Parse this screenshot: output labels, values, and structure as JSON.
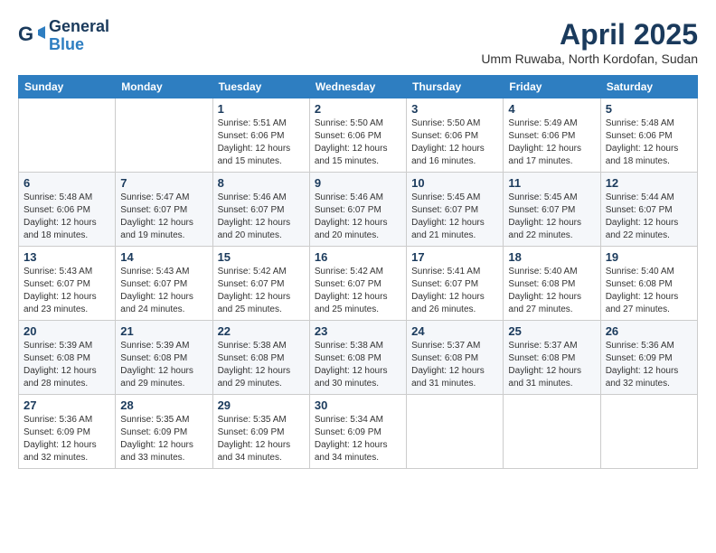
{
  "header": {
    "logo_line1": "General",
    "logo_line2": "Blue",
    "month_title": "April 2025",
    "location": "Umm Ruwaba, North Kordofan, Sudan"
  },
  "days_of_week": [
    "Sunday",
    "Monday",
    "Tuesday",
    "Wednesday",
    "Thursday",
    "Friday",
    "Saturday"
  ],
  "weeks": [
    [
      {
        "num": "",
        "info": ""
      },
      {
        "num": "",
        "info": ""
      },
      {
        "num": "1",
        "info": "Sunrise: 5:51 AM\nSunset: 6:06 PM\nDaylight: 12 hours and 15 minutes."
      },
      {
        "num": "2",
        "info": "Sunrise: 5:50 AM\nSunset: 6:06 PM\nDaylight: 12 hours and 15 minutes."
      },
      {
        "num": "3",
        "info": "Sunrise: 5:50 AM\nSunset: 6:06 PM\nDaylight: 12 hours and 16 minutes."
      },
      {
        "num": "4",
        "info": "Sunrise: 5:49 AM\nSunset: 6:06 PM\nDaylight: 12 hours and 17 minutes."
      },
      {
        "num": "5",
        "info": "Sunrise: 5:48 AM\nSunset: 6:06 PM\nDaylight: 12 hours and 18 minutes."
      }
    ],
    [
      {
        "num": "6",
        "info": "Sunrise: 5:48 AM\nSunset: 6:06 PM\nDaylight: 12 hours and 18 minutes."
      },
      {
        "num": "7",
        "info": "Sunrise: 5:47 AM\nSunset: 6:07 PM\nDaylight: 12 hours and 19 minutes."
      },
      {
        "num": "8",
        "info": "Sunrise: 5:46 AM\nSunset: 6:07 PM\nDaylight: 12 hours and 20 minutes."
      },
      {
        "num": "9",
        "info": "Sunrise: 5:46 AM\nSunset: 6:07 PM\nDaylight: 12 hours and 20 minutes."
      },
      {
        "num": "10",
        "info": "Sunrise: 5:45 AM\nSunset: 6:07 PM\nDaylight: 12 hours and 21 minutes."
      },
      {
        "num": "11",
        "info": "Sunrise: 5:45 AM\nSunset: 6:07 PM\nDaylight: 12 hours and 22 minutes."
      },
      {
        "num": "12",
        "info": "Sunrise: 5:44 AM\nSunset: 6:07 PM\nDaylight: 12 hours and 22 minutes."
      }
    ],
    [
      {
        "num": "13",
        "info": "Sunrise: 5:43 AM\nSunset: 6:07 PM\nDaylight: 12 hours and 23 minutes."
      },
      {
        "num": "14",
        "info": "Sunrise: 5:43 AM\nSunset: 6:07 PM\nDaylight: 12 hours and 24 minutes."
      },
      {
        "num": "15",
        "info": "Sunrise: 5:42 AM\nSunset: 6:07 PM\nDaylight: 12 hours and 25 minutes."
      },
      {
        "num": "16",
        "info": "Sunrise: 5:42 AM\nSunset: 6:07 PM\nDaylight: 12 hours and 25 minutes."
      },
      {
        "num": "17",
        "info": "Sunrise: 5:41 AM\nSunset: 6:07 PM\nDaylight: 12 hours and 26 minutes."
      },
      {
        "num": "18",
        "info": "Sunrise: 5:40 AM\nSunset: 6:08 PM\nDaylight: 12 hours and 27 minutes."
      },
      {
        "num": "19",
        "info": "Sunrise: 5:40 AM\nSunset: 6:08 PM\nDaylight: 12 hours and 27 minutes."
      }
    ],
    [
      {
        "num": "20",
        "info": "Sunrise: 5:39 AM\nSunset: 6:08 PM\nDaylight: 12 hours and 28 minutes."
      },
      {
        "num": "21",
        "info": "Sunrise: 5:39 AM\nSunset: 6:08 PM\nDaylight: 12 hours and 29 minutes."
      },
      {
        "num": "22",
        "info": "Sunrise: 5:38 AM\nSunset: 6:08 PM\nDaylight: 12 hours and 29 minutes."
      },
      {
        "num": "23",
        "info": "Sunrise: 5:38 AM\nSunset: 6:08 PM\nDaylight: 12 hours and 30 minutes."
      },
      {
        "num": "24",
        "info": "Sunrise: 5:37 AM\nSunset: 6:08 PM\nDaylight: 12 hours and 31 minutes."
      },
      {
        "num": "25",
        "info": "Sunrise: 5:37 AM\nSunset: 6:08 PM\nDaylight: 12 hours and 31 minutes."
      },
      {
        "num": "26",
        "info": "Sunrise: 5:36 AM\nSunset: 6:09 PM\nDaylight: 12 hours and 32 minutes."
      }
    ],
    [
      {
        "num": "27",
        "info": "Sunrise: 5:36 AM\nSunset: 6:09 PM\nDaylight: 12 hours and 32 minutes."
      },
      {
        "num": "28",
        "info": "Sunrise: 5:35 AM\nSunset: 6:09 PM\nDaylight: 12 hours and 33 minutes."
      },
      {
        "num": "29",
        "info": "Sunrise: 5:35 AM\nSunset: 6:09 PM\nDaylight: 12 hours and 34 minutes."
      },
      {
        "num": "30",
        "info": "Sunrise: 5:34 AM\nSunset: 6:09 PM\nDaylight: 12 hours and 34 minutes."
      },
      {
        "num": "",
        "info": ""
      },
      {
        "num": "",
        "info": ""
      },
      {
        "num": "",
        "info": ""
      }
    ]
  ]
}
